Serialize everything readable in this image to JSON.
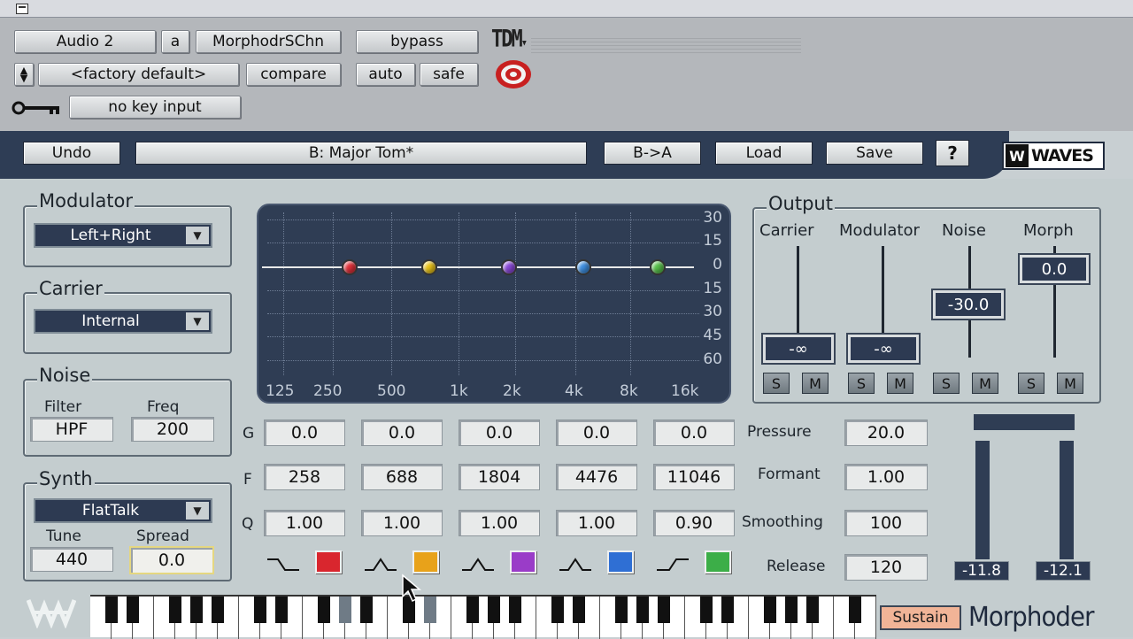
{
  "host": {
    "track": "Audio 2",
    "track_letter": "a",
    "insert": "MorphodrSChn",
    "bypass": "bypass",
    "tdm": "TDM",
    "preset": "<factory default>",
    "compare": "compare",
    "auto": "auto",
    "safe": "safe",
    "key_input": "no key input",
    "icons": {
      "window": "window-icon",
      "stepper": "up-down-arrows-icon",
      "key": "key-icon",
      "target": "target-icon",
      "tdm_menu": "chevron-down-icon"
    }
  },
  "toolbar": {
    "undo": "Undo",
    "preset_name": "B: Major Tom*",
    "b_to_a": "B->A",
    "load": "Load",
    "save": "Save",
    "help": "?",
    "brand": "WAVES"
  },
  "modulator": {
    "title": "Modulator",
    "value": "Left+Right"
  },
  "carrier": {
    "title": "Carrier",
    "value": "Internal"
  },
  "noise": {
    "title": "Noise",
    "filter_label": "Filter",
    "filter_value": "HPF",
    "freq_label": "Freq",
    "freq_value": "200"
  },
  "synth": {
    "title": "Synth",
    "value": "FlatTalk",
    "tune_label": "Tune",
    "tune_value": "440",
    "spread_label": "Spread",
    "spread_value": "0.0"
  },
  "eq_display": {
    "y_ticks": [
      "30",
      "15",
      "0",
      "15",
      "30",
      "45",
      "60"
    ],
    "x_ticks": [
      "125",
      "250",
      "500",
      "1k",
      "2k",
      "4k",
      "8k",
      "16k"
    ],
    "bands": [
      {
        "color": "#e0313a"
      },
      {
        "color": "#e8c21a"
      },
      {
        "color": "#8a48d8"
      },
      {
        "color": "#3f8fe0"
      },
      {
        "color": "#58c04a"
      }
    ]
  },
  "bands": {
    "row_labels": {
      "g": "G",
      "f": "F",
      "q": "Q"
    },
    "gain": [
      "0.0",
      "0.0",
      "0.0",
      "0.0",
      "0.0"
    ],
    "freq": [
      "258",
      "688",
      "1804",
      "4476",
      "11046"
    ],
    "q": [
      "1.00",
      "1.00",
      "1.00",
      "1.00",
      "0.90"
    ],
    "swatch_colors": [
      "#d9262e",
      "#e8a21a",
      "#9a3cc8",
      "#2f6fd4",
      "#3cae48"
    ],
    "shape_icons": [
      "low-shelf-icon",
      "bell-icon",
      "bell-icon",
      "bell-icon",
      "high-shelf-icon"
    ]
  },
  "params": {
    "pressure_label": "Pressure",
    "pressure": "20.0",
    "formant_label": "Formant",
    "formant": "1.00",
    "smoothing_label": "Smoothing",
    "smoothing": "100",
    "release_label": "Release",
    "release": "120"
  },
  "output": {
    "title": "Output",
    "channels": [
      {
        "label": "Carrier",
        "value": "-∞"
      },
      {
        "label": "Modulator",
        "value": "-∞"
      },
      {
        "label": "Noise",
        "value": "-30.0"
      },
      {
        "label": "Morph",
        "value": "0.0"
      }
    ],
    "solo": "S",
    "mute": "M",
    "meter_left": "-11.8",
    "meter_right": "-12.1"
  },
  "footer": {
    "sustain": "Sustain",
    "product": "Morphoder"
  }
}
